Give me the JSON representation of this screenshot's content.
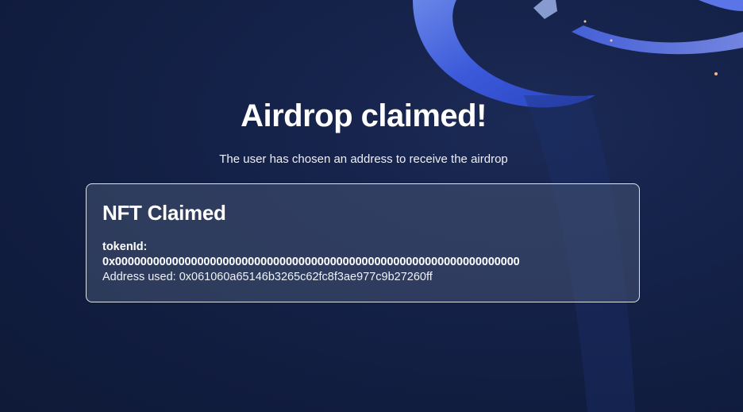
{
  "page": {
    "title": "Airdrop claimed!",
    "subtitle": "The user has chosen an address to receive the airdrop"
  },
  "card": {
    "title": "NFT Claimed",
    "token_label": "tokenId:",
    "token_value": "0x0000000000000000000000000000000000000000000000000000000000000000",
    "address_prefix": "Address used:",
    "address_value": "0x061060a65146b3265c62fc8f3ae977c9b27260ff"
  },
  "colors": {
    "background": "#111d3f",
    "accent_blue": "#3b5bdb",
    "card_border": "#ffffff"
  }
}
